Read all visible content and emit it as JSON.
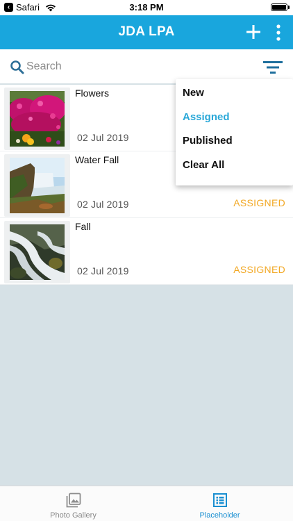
{
  "status_bar": {
    "back_app": "Safari",
    "time": "3:18 PM"
  },
  "header": {
    "title": "JDA LPA",
    "icons": {
      "add": "plus-icon",
      "more": "vertical-dots-icon"
    },
    "color": "#19a6dd"
  },
  "search": {
    "placeholder": "Search",
    "value": "",
    "icon": "search-icon",
    "filter_icon": "filter-icon"
  },
  "list": {
    "items": [
      {
        "title": "Flowers",
        "date": "02 Jul 2019",
        "status": ""
      },
      {
        "title": "Water Fall",
        "date": "02 Jul 2019",
        "status": "ASSIGNED"
      },
      {
        "title": "Fall",
        "date": "02 Jul 2019",
        "status": "ASSIGNED"
      }
    ],
    "status_color": "#f2a824"
  },
  "filter_menu": {
    "items": [
      {
        "label": "New",
        "active": false
      },
      {
        "label": "Assigned",
        "active": true
      },
      {
        "label": "Published",
        "active": false
      },
      {
        "label": "Clear All",
        "active": false
      }
    ],
    "active_color": "#2aa8d8"
  },
  "tab_bar": {
    "tabs": [
      {
        "label": "Photo Gallery",
        "icon": "image-gallery-icon",
        "selected": false
      },
      {
        "label": "Placeholder",
        "icon": "list-icon",
        "selected": true
      }
    ],
    "selected_color": "#1a8fd1"
  }
}
